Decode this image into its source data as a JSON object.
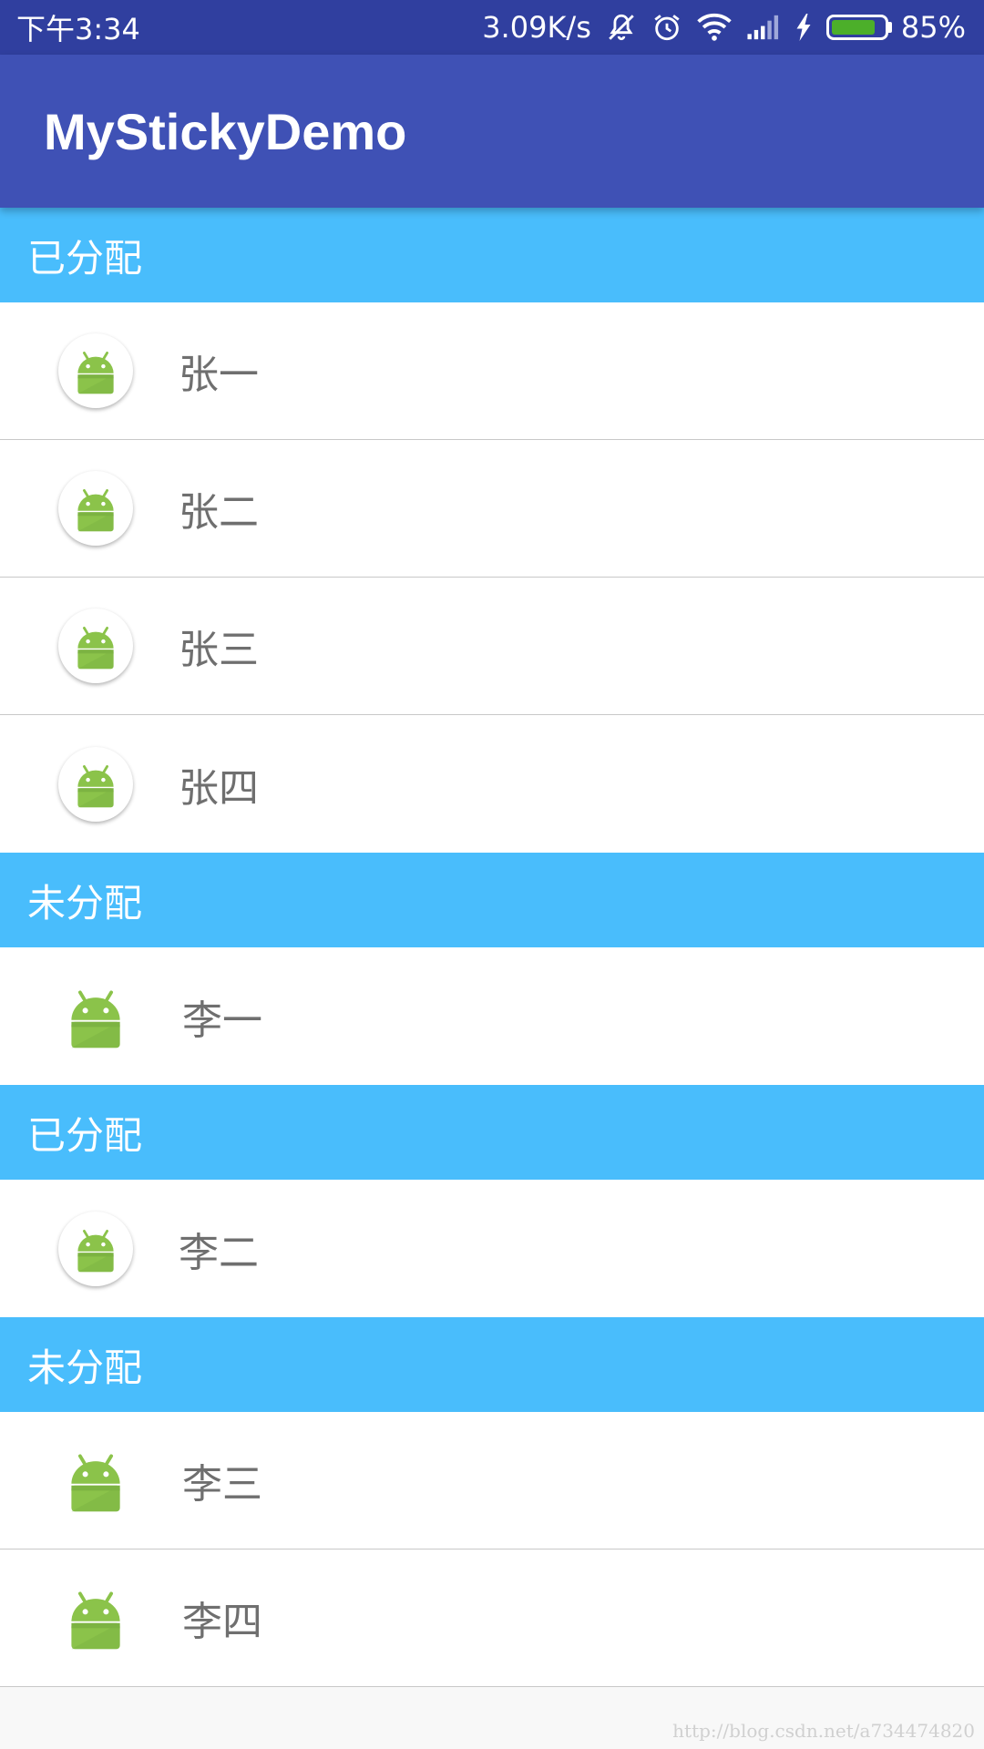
{
  "status_bar": {
    "time": "下午3:34",
    "network_speed": "3.09K/s",
    "battery_percent": "85%",
    "battery_level": 0.85,
    "icons": [
      "mute-bell-icon",
      "alarm-icon",
      "wifi-icon",
      "signal-icon",
      "charging-icon",
      "battery-icon"
    ]
  },
  "app_bar": {
    "title": "MyStickyDemo"
  },
  "sections": [
    {
      "header": "已分配",
      "items": [
        {
          "name": "张一",
          "icon": "android-round-icon"
        },
        {
          "name": "张二",
          "icon": "android-round-icon"
        },
        {
          "name": "张三",
          "icon": "android-round-icon"
        },
        {
          "name": "张四",
          "icon": "android-round-icon"
        }
      ]
    },
    {
      "header": "未分配",
      "items": [
        {
          "name": "李一",
          "icon": "android-icon"
        }
      ]
    },
    {
      "header": "已分配",
      "items": [
        {
          "name": "李二",
          "icon": "android-round-icon"
        }
      ]
    },
    {
      "header": "未分配",
      "items": [
        {
          "name": "李三",
          "icon": "android-icon"
        },
        {
          "name": "李四",
          "icon": "android-icon"
        }
      ]
    }
  ],
  "watermark": "http://blog.csdn.net/a734474820",
  "colors": {
    "status_bar": "#303f9f",
    "app_bar": "#3f51b5",
    "section_header": "#49bdfc",
    "android_green": "#8bc34a"
  }
}
